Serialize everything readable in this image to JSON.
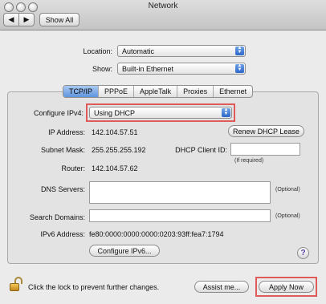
{
  "window": {
    "title": "Network"
  },
  "toolbar": {
    "back": "◀",
    "forward": "▶",
    "show_all": "Show All"
  },
  "location": {
    "label": "Location:",
    "value": "Automatic"
  },
  "show": {
    "label": "Show:",
    "value": "Built-in Ethernet"
  },
  "tabs": [
    {
      "label": "TCP/IP",
      "active": true
    },
    {
      "label": "PPPoE",
      "active": false
    },
    {
      "label": "AppleTalk",
      "active": false
    },
    {
      "label": "Proxies",
      "active": false
    },
    {
      "label": "Ethernet",
      "active": false
    }
  ],
  "tcpip": {
    "configure_label": "Configure IPv4:",
    "configure_value": "Using DHCP",
    "ip_label": "IP Address:",
    "ip_value": "142.104.57.51",
    "renew_button": "Renew DHCP Lease",
    "subnet_label": "Subnet Mask:",
    "subnet_value": "255.255.255.192",
    "dhcp_client_label": "DHCP Client ID:",
    "dhcp_client_value": "",
    "if_required": "(If required)",
    "router_label": "Router:",
    "router_value": "142.104.57.62",
    "dns_label": "DNS Servers:",
    "dns_value": "",
    "optional": "(Optional)",
    "search_label": "Search Domains:",
    "search_value": "",
    "ipv6_label": "IPv6 Address:",
    "ipv6_value": "fe80:0000:0000:0000:0203:93ff:fea7:1794",
    "configure_ipv6_button": "Configure IPv6...",
    "help": "?"
  },
  "footer": {
    "lock_text": "Click the lock to prevent further changes.",
    "assist_button": "Assist me...",
    "apply_button": "Apply Now"
  },
  "colors": {
    "highlight_outline": "#e05a5a",
    "active_tab": "#5f95df",
    "popup_arrow": "#2c66c8"
  }
}
